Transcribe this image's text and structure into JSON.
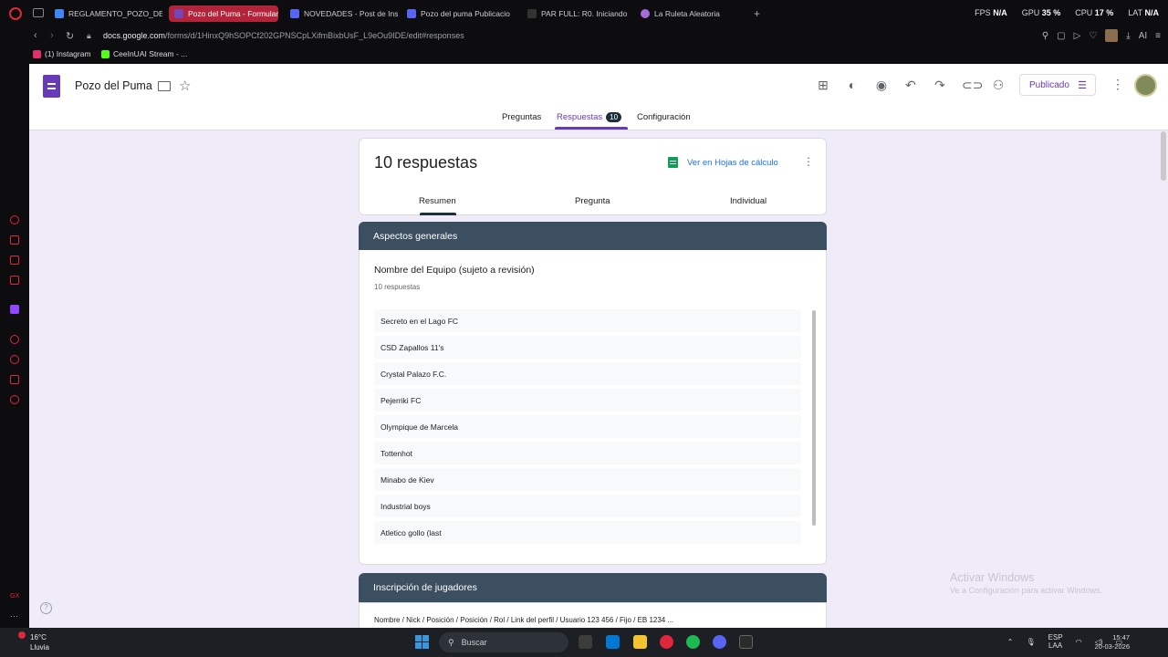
{
  "browser": {
    "tabs": [
      {
        "label": "REGLAMENTO_POZO_DEL",
        "color": "#4285f4",
        "active": false
      },
      {
        "label": "Pozo del Puma - Formular",
        "color": "#7248b9",
        "active": true
      },
      {
        "label": "NOVEDADES - Post de Ins",
        "color": "#5865f2",
        "active": false
      },
      {
        "label": "Pozo del puma Publicacio",
        "color": "#5865f2",
        "active": false
      },
      {
        "label": "PAR FULL: R0. Iniciando c",
        "color": "#333333",
        "active": false
      },
      {
        "label": "La Ruleta Aleatoria",
        "color": "#a66bd6",
        "active": false
      }
    ],
    "new_tab": "+",
    "stats": {
      "fps_label": "FPS",
      "fps_value": "N/A",
      "gpu_label": "GPU",
      "gpu_value": "35 %",
      "cpu_label": "CPU",
      "cpu_value": "17 %",
      "lat_label": "LAT",
      "lat_value": "N/A"
    },
    "url_host": "docs.google.com",
    "url_path": "/forms/d/1HinxQ9hSOPCf202GPNSCpLXifmBixbUsF_L9eOu9IDE/edit#responses",
    "ai_label": "AI",
    "bookmarks": [
      {
        "label": "(1) Instagram",
        "color": "#e1306c"
      },
      {
        "label": "CeeInUAI Stream - ...",
        "color": "#53fc18"
      }
    ]
  },
  "form": {
    "title": "Pozo del Puma",
    "publish_label": "Publicado",
    "tabs": {
      "questions": "Preguntas",
      "responses": "Respuestas",
      "responses_badge": "10",
      "settings": "Configuración"
    },
    "summary": {
      "count_title": "10 respuestas",
      "sheets_link": "Ver en Hojas de cálculo",
      "sub_tabs": [
        "Resumen",
        "Pregunta",
        "Individual"
      ]
    },
    "sections": [
      {
        "title": "Aspectos generales",
        "question": "Nombre del Equipo (sujeto a revisión)",
        "response_count": "10 respuestas",
        "answers": [
          "Secreto en el Lago FC",
          "CSD Zapallos 11's",
          "Crystal Palazo F.C.",
          "Pejerriki FC",
          "Olympique de Marcela",
          "Tottenhot",
          "Minabo de Kiev",
          "Industrial boys",
          "Atletico gollo (last"
        ]
      },
      {
        "title": "Inscripción de jugadores",
        "question_partial": "Nombre / Nick / Posición / Posición / Rol / Link del perfil / Usuario 123 456 / Fijo / EB 1234 ..."
      }
    ]
  },
  "windows": {
    "activate_title": "Activar Windows",
    "activate_sub": "Ve a Configuración para activar Windows.",
    "weather_temp": "16°C",
    "weather_desc": "Lluvia",
    "search_label": "Buscar",
    "lang_top": "ESP",
    "lang_bottom": "LAA",
    "time": "15:47",
    "date": "20-03-2026"
  }
}
